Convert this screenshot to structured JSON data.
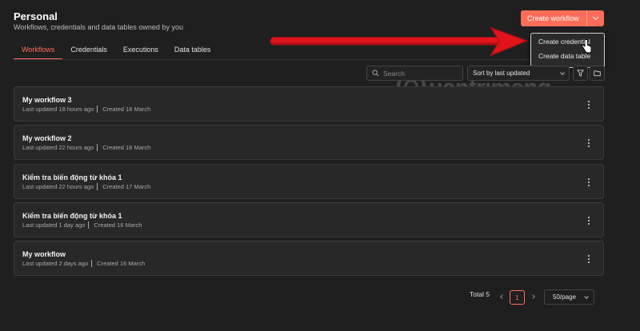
{
  "header": {
    "title": "Personal",
    "subtitle": "Workflows, credentials and data tables owned by you"
  },
  "tabs": [
    {
      "label": "Workflows",
      "active": true
    },
    {
      "label": "Credentials",
      "active": false
    },
    {
      "label": "Executions",
      "active": false
    },
    {
      "label": "Data tables",
      "active": false
    }
  ],
  "create_button": {
    "label": "Create workflow"
  },
  "dropdown": {
    "items": [
      "Create credential",
      "Create data table"
    ]
  },
  "toolbar": {
    "search_placeholder": "Search",
    "sort_label": "Sort by last updated"
  },
  "workflows": [
    {
      "name": "My workflow 3",
      "updated": "Last updated 18 hours ago",
      "created": "Created 18 March"
    },
    {
      "name": "My workflow 2",
      "updated": "Last updated 22 hours ago",
      "created": "Created 16 March"
    },
    {
      "name": "Kiểm tra biến động từ khóa 1",
      "updated": "Last updated 22 hours ago",
      "created": "Created 17 March"
    },
    {
      "name": "Kiểm tra biến động từ khóa 1",
      "updated": "Last updated 1 day ago",
      "created": "Created 16 March"
    },
    {
      "name": "My workflow",
      "updated": "Last updated 2 days ago",
      "created": "Created 16 March"
    }
  ],
  "pagination": {
    "total_label": "Total 5",
    "current_page": "1",
    "per_page": "50/page"
  },
  "watermark": {
    "text": "uantrimang"
  },
  "colors": {
    "accent": "#ff6d5a",
    "background": "#1f1f20",
    "arrow": "#e0141a"
  },
  "icons": [
    "search-icon",
    "chevron-down-icon",
    "filter-icon",
    "folder-icon",
    "kebab-menu-icon",
    "hand-cursor-icon",
    "arrow-annotation"
  ]
}
